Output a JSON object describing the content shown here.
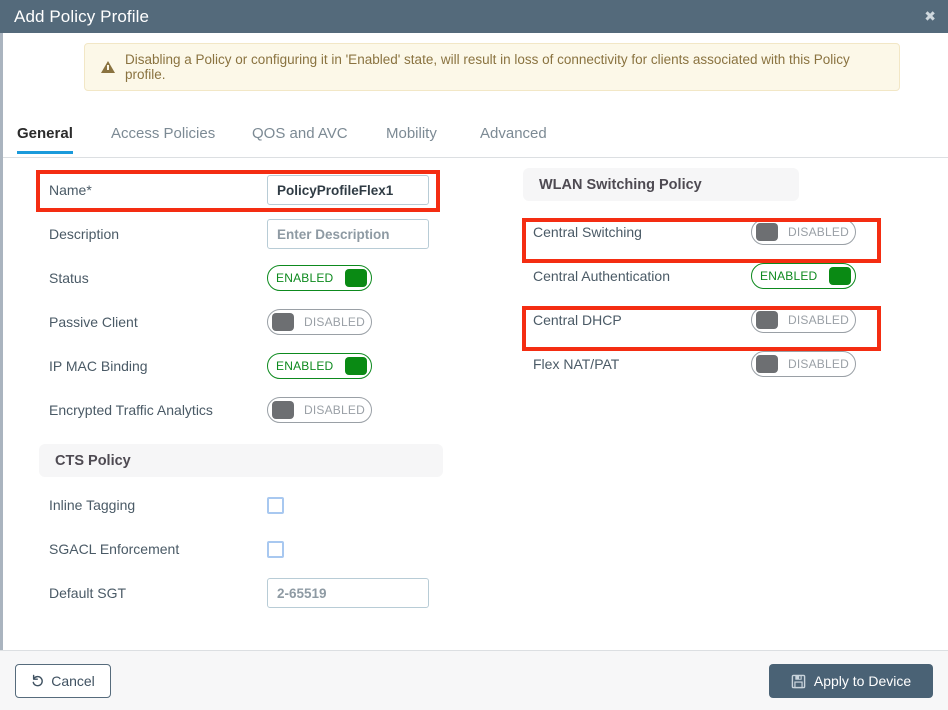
{
  "window": {
    "title": "Add Policy Profile",
    "close_icon": "close-icon",
    "close_glyph": "✖"
  },
  "banner": {
    "icon": "warning-triangle-icon",
    "text": "Disabling a Policy or configuring it in 'Enabled' state, will result in loss of connectivity for clients associated with this Policy profile."
  },
  "tabs": [
    {
      "label": "General",
      "active": true
    },
    {
      "label": "Access Policies",
      "active": false
    },
    {
      "label": "QOS and AVC",
      "active": false
    },
    {
      "label": "Mobility",
      "active": false
    },
    {
      "label": "Advanced",
      "active": false
    }
  ],
  "left_column": {
    "fields": {
      "name": {
        "label": "Name*",
        "value": "PolicyProfileFlex1",
        "highlighted": true
      },
      "description": {
        "label": "Description",
        "placeholder": "Enter Description",
        "value": ""
      },
      "status": {
        "label": "Status",
        "state": "ENABLED"
      },
      "passive_client": {
        "label": "Passive Client",
        "state": "DISABLED"
      },
      "ip_mac_binding": {
        "label": "IP MAC Binding",
        "state": "ENABLED"
      },
      "encrypted_traffic_analytics": {
        "label": "Encrypted Traffic Analytics",
        "state": "DISABLED"
      }
    },
    "cts_policy": {
      "section_title": "CTS Policy",
      "inline_tagging": {
        "label": "Inline Tagging",
        "checked": false
      },
      "sgacl_enforcement": {
        "label": "SGACL Enforcement",
        "checked": false
      },
      "default_sgt": {
        "label": "Default SGT",
        "placeholder": "2-65519",
        "value": ""
      }
    }
  },
  "right_column": {
    "section_title": "WLAN Switching Policy",
    "central_switching": {
      "label": "Central Switching",
      "state": "DISABLED",
      "highlighted": true
    },
    "central_authentication": {
      "label": "Central Authentication",
      "state": "ENABLED",
      "highlighted": false
    },
    "central_dhcp": {
      "label": "Central DHCP",
      "state": "DISABLED",
      "highlighted": true
    },
    "flex_nat_pat": {
      "label": "Flex NAT/PAT",
      "state": "DISABLED",
      "highlighted": false
    }
  },
  "footer": {
    "cancel": {
      "label": "Cancel",
      "icon": "undo-arrow-icon"
    },
    "apply": {
      "label": "Apply to Device",
      "icon": "save-disk-icon"
    }
  },
  "colors": {
    "titlebar": "#546a7b",
    "accent_tab": "#1a9adb",
    "enabled_green": "#0a8a14",
    "disabled_gray": "#6d6f72",
    "highlight_red": "#f42d12",
    "banner_bg": "#fcf8e8",
    "banner_text": "#8a7340",
    "apply_button": "#4a6275"
  }
}
